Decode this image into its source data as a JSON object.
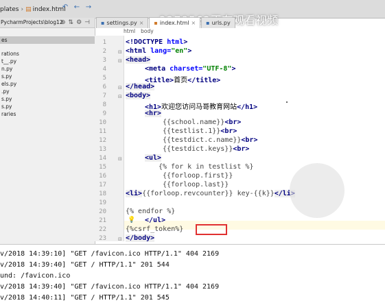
{
  "toolbar": {
    "crumb_folder": "plates",
    "crumb_file": "index.html",
    "watermark": "2278562正在观看视频"
  },
  "tabs": [
    {
      "label": "settings.py"
    },
    {
      "label": "index.html"
    },
    {
      "label": "urls.py"
    }
  ],
  "project": {
    "root_label": "PycharmProjects\\blog12",
    "items": [
      {
        "label": "es"
      },
      {
        "label": "rations"
      },
      {
        "label": "t__.py"
      },
      {
        "label": "n.py"
      },
      {
        "label": "s.py"
      },
      {
        "label": "els.py"
      },
      {
        "label": ".py"
      },
      {
        "label": "s.py"
      },
      {
        "label": "s.py"
      },
      {
        "label": "raries"
      }
    ]
  },
  "editor": {
    "breadcrumb": [
      "html",
      "body"
    ],
    "line_numbers": [
      "1",
      "2",
      "3",
      "4",
      "5",
      "6",
      "7",
      "8",
      "9",
      "10",
      "11",
      "12",
      "13",
      "14",
      "15",
      "16",
      "17",
      "18",
      "19",
      "20",
      "21",
      "22",
      "23"
    ],
    "lines": {
      "l1_a": "<!DOCTYPE ",
      "l1_b": "html",
      "l1_c": ">",
      "l2_a": "<html ",
      "l2_b": "lang=",
      "l2_c": "\"en\"",
      "l2_d": ">",
      "l3": "<head>",
      "l4_a": "<meta ",
      "l4_b": "charset=",
      "l4_c": "\"UTF-8\"",
      "l4_d": ">",
      "l5_a": "<title>",
      "l5_b": "首页",
      "l5_c": "</title>",
      "l6": "</head>",
      "l7": "<body>",
      "l8_a": "<h1>",
      "l8_b": "欢迎您访问马哥教育网站",
      "l8_c": "</h1>",
      "l9": "<hr>",
      "l10_a": "{{school.name}}",
      "l10_b": "<br>",
      "l11_a": "{{testlist.1}}",
      "l11_b": "<br>",
      "l12_a": "{{testdict.c.name}}",
      "l12_b": "<br>",
      "l13_a": "{{testdict.keys}}",
      "l13_b": "<br>",
      "l14": "<ul>",
      "l15": "{% for k in testlist %}",
      "l16": "{{forloop.first}}",
      "l17": "{{forloop.last}}",
      "l18_a": "<li>",
      "l18_b": "{{forloop.revcounter}} key-{{k}}",
      "l18_c": "</li>",
      "l20": "{% endfor %}",
      "l21": "</ul>",
      "l22": "{%csrf_token%}",
      "l23": "</body>"
    }
  },
  "console": {
    "lines": [
      "v/2018 14:39:10] \"GET /favicon.ico HTTP/1.1\" 404 2169",
      "v/2018 14:39:40] \"GET / HTTP/1.1\" 201 544",
      "und: /favicon.ico",
      "v/2018 14:39:40] \"GET /favicon.ico HTTP/1.1\" 404 2169",
      "v/2018 14:40:11] \"GET / HTTP/1.1\" 201 545"
    ]
  }
}
